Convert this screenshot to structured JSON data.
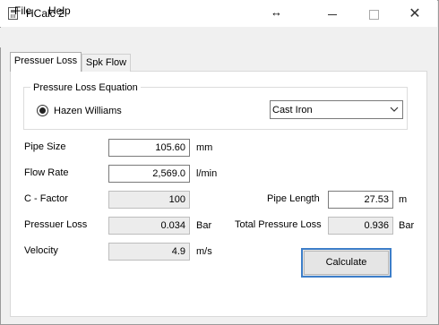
{
  "window": {
    "title": "HCalc 2"
  },
  "menu": {
    "file": "File",
    "help": "Help"
  },
  "tabs": [
    {
      "label": "Pressuer Loss"
    },
    {
      "label": "Spk Flow"
    }
  ],
  "equation": {
    "legend": "Pressure Loss Equation",
    "method": "Hazen Williams",
    "material": "Cast Iron"
  },
  "fields": {
    "pipe_size": {
      "label": "Pipe Size",
      "value": "105.60",
      "unit": "mm"
    },
    "flow_rate": {
      "label": "Flow Rate",
      "value": "2,569.0",
      "unit": "l/min"
    },
    "c_factor": {
      "label": "C - Factor",
      "value": "100"
    },
    "pressure_loss": {
      "label": "Pressuer Loss",
      "value": "0.034",
      "unit": "Bar"
    },
    "velocity": {
      "label": "Velocity",
      "value": "4.9",
      "unit": "m/s"
    },
    "pipe_length": {
      "label": "Pipe Length",
      "value": "27.53",
      "unit": "m"
    },
    "total_pressure_loss": {
      "label": "Total Pressure Loss",
      "value": "0.936",
      "unit": "Bar"
    }
  },
  "buttons": {
    "calculate": "Calculate"
  },
  "colors": {
    "accent": "#3d7ec9",
    "panel": "#ffffff",
    "chrome": "#f0f0f0"
  }
}
